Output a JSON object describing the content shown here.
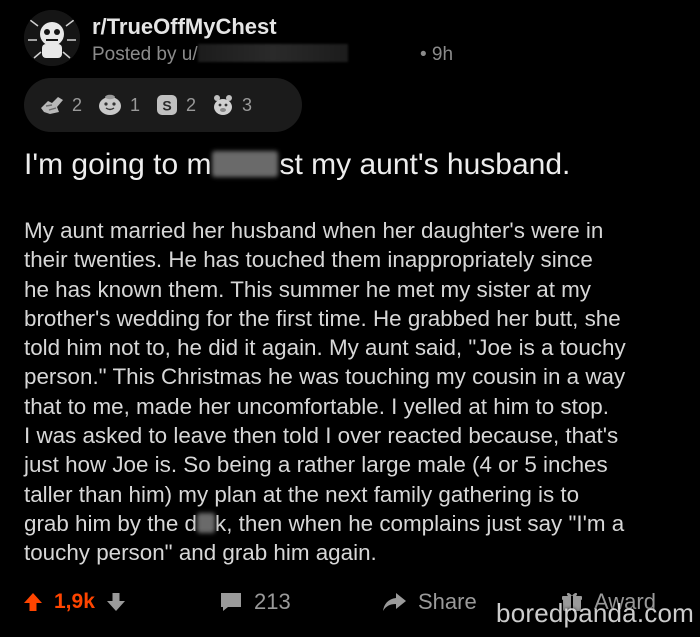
{
  "post": {
    "subreddit": "r/TrueOffMyChest",
    "posted_by_prefix": "Posted by u/",
    "time": "• 9h",
    "awards": [
      {
        "icon": "helpful-award-icon",
        "count": "2"
      },
      {
        "icon": "wholesome-award-icon",
        "count": "1"
      },
      {
        "icon": "silver-award-icon",
        "count": "2"
      },
      {
        "icon": "bravo-award-icon",
        "count": "3"
      }
    ],
    "title_before": "I'm going to m",
    "title_after": "st my aunt's husband.",
    "body_lines": [
      "My aunt married her husband when her daughter's were in",
      "their twenties. He has touched them inappropriately since",
      "he has known them. This summer he met my sister at my",
      "brother's wedding for the first time. He grabbed her butt, she",
      "told him not to, he did it again. My aunt said, \"Joe is a touchy",
      "person.\" This Christmas he was touching my cousin in a way",
      "that to me, made her uncomfortable. I yelled at him to stop.",
      "I was asked to leave then told I over reacted because, that's",
      "just how Joe is. So being a rather large male (4 or 5 inches",
      "taller than him)  my plan at the next family gathering is to"
    ],
    "body_line_11_before": "grab him by the d",
    "body_line_11_after": "k, then when he complains just say \"I'm a",
    "body_line_12": "touchy person\" and grab him again.",
    "actions": {
      "vote_count": "1,9k",
      "comment_count": "213",
      "share_label": "Share",
      "award_label": "Award"
    }
  },
  "watermark": "boredpanda.com",
  "colors": {
    "background": "#000000",
    "upvote_accent": "#ff4500",
    "muted": "#8b8b8b"
  }
}
